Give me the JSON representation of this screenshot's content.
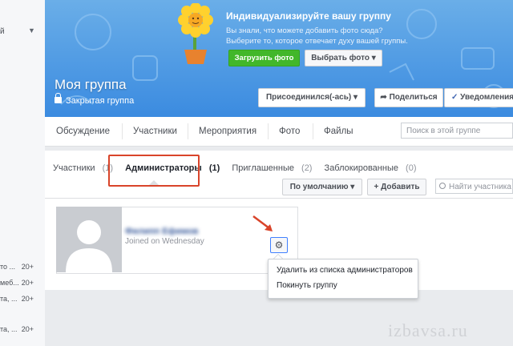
{
  "sidebar": {
    "top_label": "й",
    "items": [
      {
        "label": "то ...",
        "count": "20+"
      },
      {
        "label": "меб...",
        "count": "20+"
      },
      {
        "label": "та, ...",
        "count": "20+"
      },
      {
        "label": "та, ...",
        "count": "20+"
      }
    ]
  },
  "cover": {
    "promo_title": "Индивидуализируйте вашу группу",
    "promo_line1": "Вы знали, что можете добавить фото сюда?",
    "promo_line2": "Выберите то, которое отвечает духу вашей группы.",
    "upload_label": "Загрузить фото",
    "choose_label": "Выбрать фото ▾",
    "group_name": "Моя группа",
    "group_type": "Закрытая группа",
    "join_label": "Присоединился(-ась) ▾",
    "share_label": "Поделиться",
    "notif_label": "Уведомления"
  },
  "tabs": [
    "Обсуждение",
    "Участники",
    "Мероприятия",
    "Фото",
    "Файлы"
  ],
  "search_placeholder": "Поиск в этой группе",
  "members": {
    "subtabs": [
      {
        "label": "Участники",
        "count": "(1)"
      },
      {
        "label": "Администраторы",
        "count": "(1)"
      },
      {
        "label": "Приглашенные",
        "count": "(2)"
      },
      {
        "label": "Заблокированные",
        "count": "(0)"
      }
    ],
    "sort_label": "По умолчанию ▾",
    "add_label": "+ Добавить",
    "find_placeholder": "Найти участника",
    "member_name": "Филипп Ефимов",
    "member_joined": "Joined on Wednesday",
    "menu_items": [
      "Удалить из списка администраторов",
      "Покинуть группу"
    ]
  },
  "watermark": "izbavsa.ru",
  "colors": {
    "accent": "#4267b2",
    "cover": "#3b8be0",
    "highlight": "#d9442a",
    "upload": "#42b72a"
  }
}
